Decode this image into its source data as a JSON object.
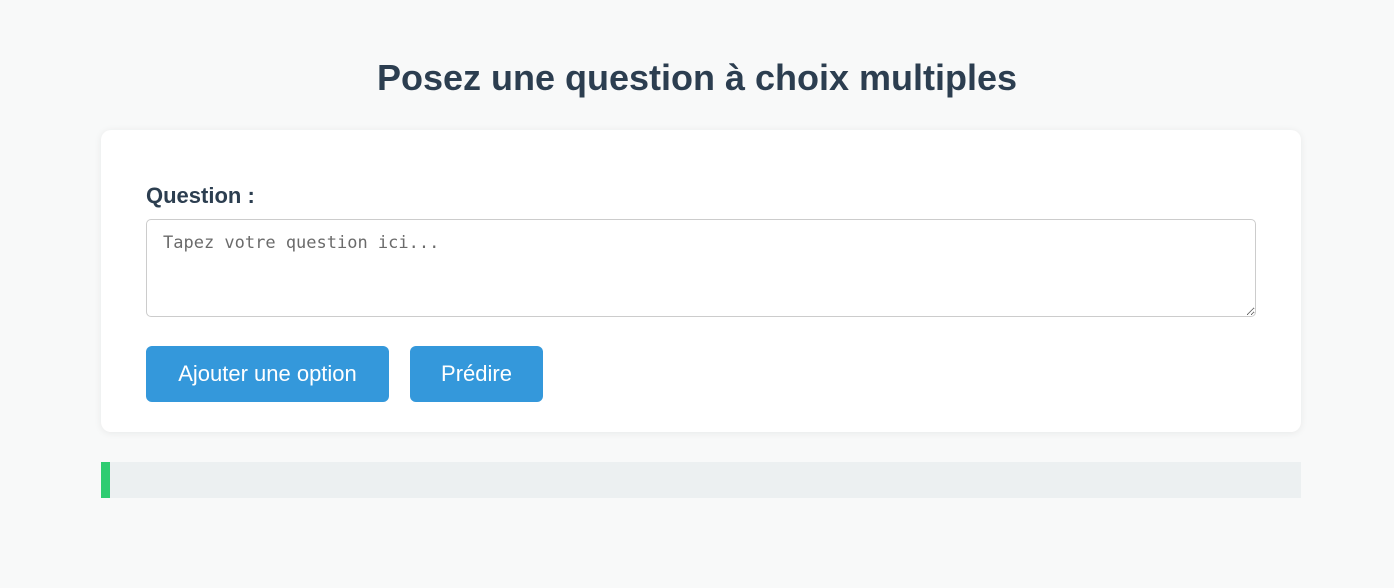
{
  "page": {
    "title": "Posez une question à choix multiples"
  },
  "form": {
    "question_label": "Question :",
    "question_value": "",
    "question_placeholder": "Tapez votre question ici...",
    "add_option_label": "Ajouter une option",
    "predict_label": "Prédire"
  },
  "result": {
    "text": "",
    "accent_color": "#2ecc71"
  },
  "colors": {
    "button": "#3498db",
    "heading": "#2c3e50",
    "background": "#f8f9f9",
    "result_background": "#ecf0f1"
  }
}
